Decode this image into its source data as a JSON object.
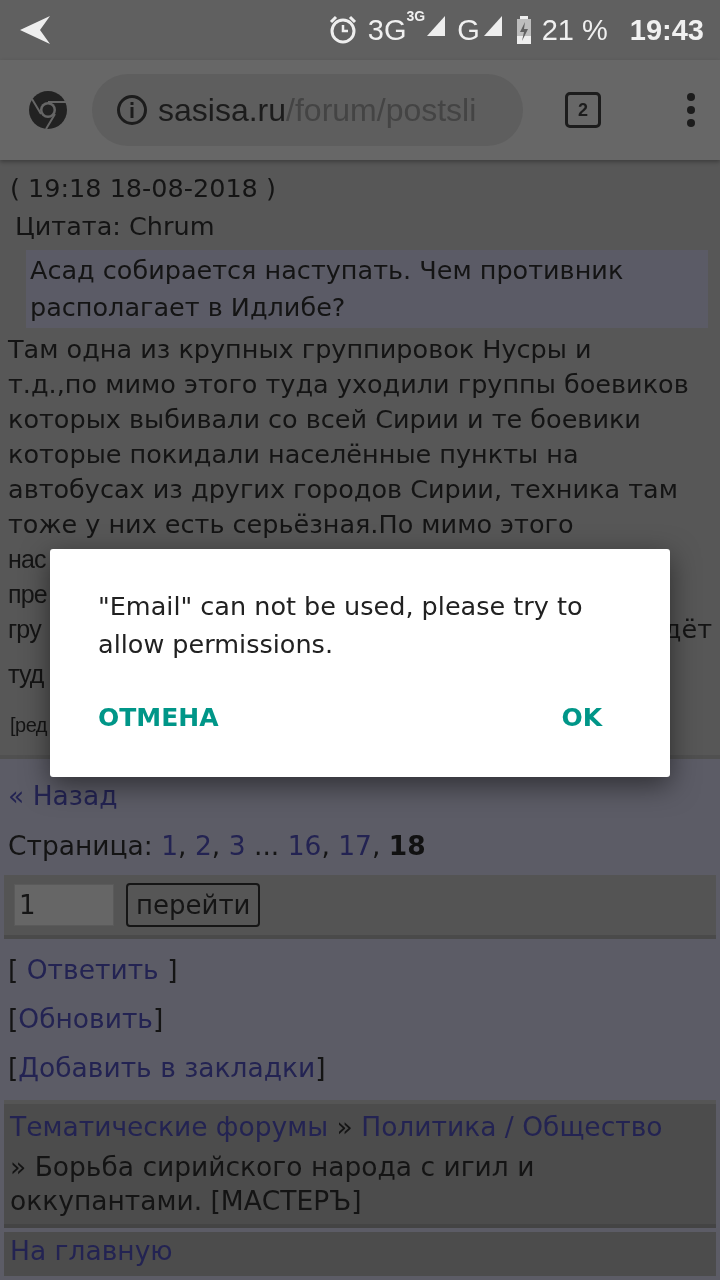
{
  "status_bar": {
    "network_1": "3G",
    "network_1_badge": "3G",
    "network_2": "G",
    "battery": "21 %",
    "time": "19:43"
  },
  "browser": {
    "url_host": "sasisa.ru",
    "url_path": "/forum/postsli",
    "tab_count": "2"
  },
  "post": {
    "date": "( 19:18 18-08-2018 )",
    "quote_label": "Цитата: Chrum",
    "quote": "Асад собирается наступать. Чем противник располагает в Идлибе?",
    "body_lines": [
      {
        "kind": "line",
        "text": "Там одна из крупных группировок Нусры и"
      },
      {
        "kind": "line",
        "text": "т.д.,по мимо этого туда уходили группы боевиков"
      },
      {
        "kind": "line",
        "text": "которых выбивали со всей Сирии и те боевики"
      },
      {
        "kind": "line",
        "text": "которые покидали населённые пункты на"
      },
      {
        "kind": "line",
        "text": "автобусах из других городов Сирии, техника там"
      },
      {
        "kind": "line",
        "text": "тоже у них есть серьёзная.По мимо этого"
      },
      {
        "kind": "fragment",
        "text": "нас"
      },
      {
        "kind": "fragment",
        "text": "пре"
      },
      {
        "kind": "fragment",
        "text": "гру",
        "tail": "дёт"
      },
      {
        "kind": "fragment",
        "text": "туд"
      }
    ],
    "edit_link": "[ред"
  },
  "back_link": "« Назад",
  "pagination": {
    "label": "Страница:",
    "pages": [
      {
        "label": "1",
        "sep": ", ",
        "selected": false
      },
      {
        "label": "2",
        "sep": ", ",
        "selected": false
      },
      {
        "label": "3",
        "sep": " ... ",
        "selected": false
      },
      {
        "label": "16",
        "sep": ", ",
        "selected": false
      },
      {
        "label": "17",
        "sep": ", ",
        "selected": false
      },
      {
        "label": "18",
        "selected": true
      }
    ]
  },
  "goto": {
    "value": "1",
    "button": "перейти"
  },
  "actions": [
    {
      "open": "[ ",
      "label": "Ответить",
      "close": " ]"
    },
    {
      "open": "[",
      "label": "Обновить",
      "close": "]"
    },
    {
      "open": "[",
      "label": "Добавить в закладки",
      "close": "]"
    }
  ],
  "breadcrumb": {
    "links": [
      {
        "label": "Тематические форумы",
        "sep": " » "
      },
      {
        "label": "Политика / Общество"
      }
    ],
    "topic": "» Борьба сирийского народа с игил и оккупантами. [МАСТЕРЪ]"
  },
  "home_link": "На главную",
  "dialog": {
    "message": "\"Email\" can not be used, please try to allow permissions.",
    "buttons": [
      {
        "label": "ОТМЕНА"
      },
      {
        "label": "OK"
      }
    ]
  }
}
